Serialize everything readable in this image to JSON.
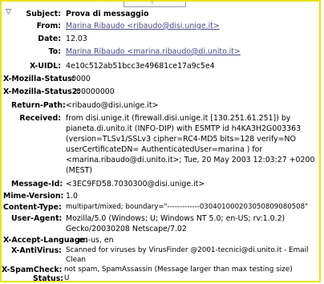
{
  "headers": {
    "subject": {
      "label": "Subject:",
      "value": "Prova di messaggio"
    },
    "from": {
      "label": "From:",
      "value": "Marina Ribaudo <ribaudo@disi.unige.it>"
    },
    "date": {
      "label": "Date:",
      "value": "12.03"
    },
    "to": {
      "label": "To:",
      "value": "Marina Ribaudo <marina.ribaudo@di.unito.it>"
    },
    "x_uidl": {
      "label": "X-UIDL:",
      "value": "4e10c512ab51bcc3e49681ce17a9c5e4"
    },
    "x_mozilla_status": {
      "label": "X-Mozilla-Status:",
      "value": "0000"
    },
    "x_mozilla_status2": {
      "label": "X-Mozilla-Status2:",
      "value": "00000000"
    },
    "return_path": {
      "label": "Return-Path:",
      "value": "<ribaudo@disi.unige.it>"
    },
    "received": {
      "label": "Received:",
      "lines": [
        "from disi.unige.it (firewall.disi.unige.it [130.251.61.251]) by",
        "pianeta.di.unito.it (INFO-DIP) with ESMTP id h4KA3H2G003363",
        "(version=TLSv1/SSLv3 cipher=RC4-MD5 bits=128 verify=NO",
        "userCertificateDN= AuthenticatedUser=marina ) for",
        "<marina.ribaudo@di.unito.it>; Tue, 20 May 2003 12:03:27 +0200",
        "(MEST)"
      ]
    },
    "message_id": {
      "label": "Message-Id:",
      "value": "<3EC9FD58.7030300@disi.unige.it>"
    },
    "mime_version": {
      "label": "Mime-Version:",
      "value": "1.0"
    },
    "content_type": {
      "label": "Content-Type:",
      "value": "multipart/mixed; boundary=\"-------------030401000203050809080508\""
    },
    "user_agent": {
      "label": "User-Agent:",
      "lines": [
        "Mozilla/5.0 (Windows; U; Windows NT 5.0; en-US; rv:1.0.2)",
        "Gecko/20030208 Netscape/7.02"
      ]
    },
    "x_accept_language": {
      "label": "X-Accept-Language:",
      "value": "en-us, en"
    },
    "x_antivirus": {
      "label": "X-AntiVirus:",
      "lines": [
        "Scanned for viruses by VirusFinder @2001-tecnici@di.unito.it - Email",
        "Clean"
      ]
    },
    "x_spamcheck": {
      "label": "X-SpamCheck:",
      "value": "not spam, SpamAssassin (Message larger than max testing size)"
    },
    "status": {
      "label": "Status:",
      "value": "U"
    }
  },
  "icons": {
    "collapse": "collapse-twisty-icon",
    "top_tab": "chevron-down-icon"
  },
  "colors": {
    "frame_border": "#e8e400",
    "link": "#4a4a8a"
  }
}
